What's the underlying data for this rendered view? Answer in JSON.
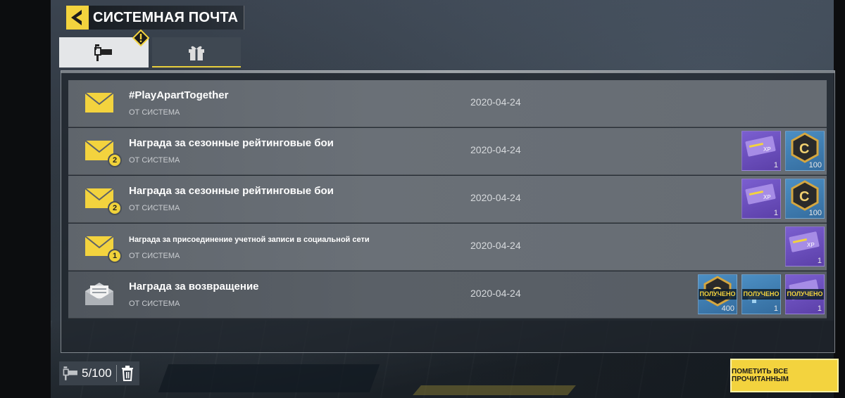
{
  "header": {
    "title": "СИСТЕМНАЯ ПОЧТА"
  },
  "tabs": [
    {
      "name": "mailbox",
      "icon": "mailbox-icon",
      "active": true
    },
    {
      "name": "gifts",
      "icon": "gift-icon",
      "active": false
    }
  ],
  "mails": [
    {
      "title": "#PlayApartTogether",
      "sender": "ОТ СИСТЕМА",
      "date": "2020-04-24",
      "attachments_count": null,
      "read": false,
      "rewards": []
    },
    {
      "title": "Награда за сезонные рейтинговые бои",
      "sender": "ОТ СИСТЕМА",
      "date": "2020-04-24",
      "attachments_count": "2",
      "read": false,
      "rewards": [
        {
          "type": "xp-card",
          "color": "purple",
          "qty": "1"
        },
        {
          "type": "cod-points",
          "color": "blue",
          "qty": "100"
        }
      ]
    },
    {
      "title": "Награда за сезонные рейтинговые бои",
      "sender": "ОТ СИСТЕМА",
      "date": "2020-04-24",
      "attachments_count": "2",
      "read": false,
      "rewards": [
        {
          "type": "xp-card",
          "color": "purple",
          "qty": "1"
        },
        {
          "type": "cod-points",
          "color": "blue",
          "qty": "100"
        }
      ]
    },
    {
      "title": "Награда за присоединение учетной записи в социальной сети",
      "sender": "ОТ СИСТЕМА",
      "date": "2020-04-24",
      "attachments_count": "1",
      "read": false,
      "rewards": [
        {
          "type": "xp-card",
          "color": "purple",
          "qty": "1"
        }
      ]
    },
    {
      "title": "Награда за возвращение",
      "sender": "ОТ СИСТЕМА",
      "date": "2020-04-24",
      "attachments_count": null,
      "read": true,
      "rewards": [
        {
          "type": "cod-points",
          "color": "blue",
          "qty": "400",
          "claimed": "ПОЛУЧЕНО"
        },
        {
          "type": "weapon",
          "color": "blue",
          "qty": "1",
          "claimed": "ПОЛУЧЕНО"
        },
        {
          "type": "xp-card",
          "color": "purple",
          "qty": "1",
          "claimed": "ПОЛУЧЕНО"
        }
      ]
    }
  ],
  "footer": {
    "mailbox_count": "5/100",
    "mark_all_read": "ПОМЕТИТЬ ВСЕ ПРОЧИТАННЫМ"
  },
  "colors": {
    "accent": "#f3d33e",
    "row": "#666c73",
    "panel_border": "#cfd3d6"
  }
}
